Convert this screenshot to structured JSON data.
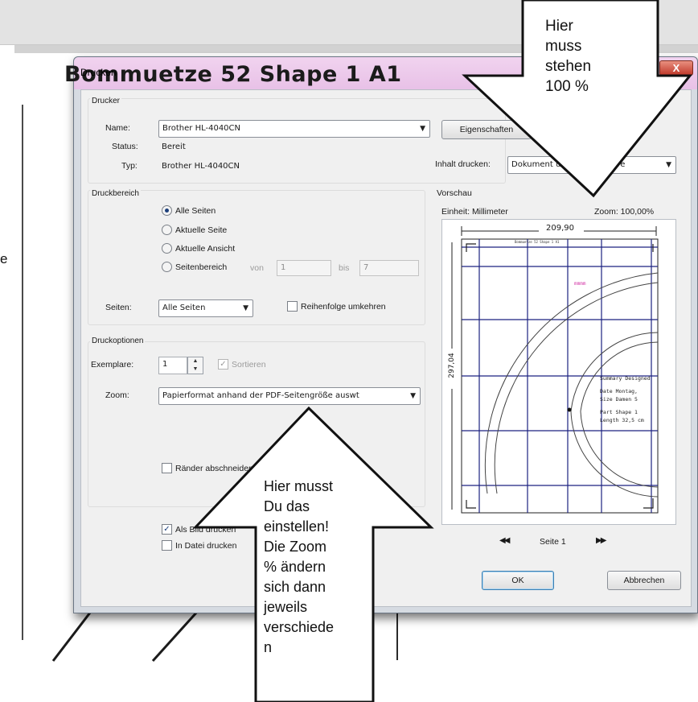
{
  "background": {
    "doc_title": "Bommuetze 52   Shape 1   A1",
    "margin_letter": "e"
  },
  "dialog": {
    "title": "Drucken",
    "close_label": "X"
  },
  "printer": {
    "group_label": "Drucker",
    "name_label": "Name:",
    "name_value": "Brother HL-4040CN",
    "status_label": "Status:",
    "status_value": "Bereit",
    "type_label": "Typ:",
    "type_value": "Brother HL-4040CN",
    "properties_button": "Eigenschaften",
    "content_label": "Inhalt drucken:",
    "content_value": "Dokument und Kommentare"
  },
  "range": {
    "group_label": "Druckbereich",
    "options": [
      "Alle Seiten",
      "Aktuelle Seite",
      "Aktuelle Ansicht",
      "Seitenbereich"
    ],
    "selected_index": 0,
    "from_label": "von",
    "from_value": "1",
    "to_label": "bis",
    "to_value": "7",
    "pages_label": "Seiten:",
    "pages_value": "Alle Seiten",
    "reverse_label": "Reihenfolge umkehren"
  },
  "options": {
    "group_label": "Druckoptionen",
    "copies_label": "Exemplare:",
    "copies_value": "1",
    "collate_label": "Sortieren",
    "zoom_label": "Zoom:",
    "zoom_value": "Papierformat anhand der PDF-Seitengröße auswt",
    "trim_label": "Ränder abschneiden",
    "as_image_label": "Als Bild drucken",
    "to_file_label": "In Datei drucken"
  },
  "preview": {
    "group_label": "Vorschau",
    "unit_label": "Einheit: Millimeter",
    "zoom_label": "Zoom: 100,00%",
    "width_value": "209,90",
    "height_value": "297,04",
    "page_header": "Bommuetze 52   Shape 1   A1",
    "note_pink": "mmmm",
    "table_rows": [
      [
        "Summary",
        "Designed"
      ],
      [
        "Date",
        "Montag,"
      ],
      [
        "Size",
        "Damen 5"
      ],
      [
        "Part",
        "Shape 1"
      ],
      [
        "Length",
        "32,5 cm"
      ]
    ],
    "prev_label": "◀◀",
    "page_label": "Seite 1",
    "next_label": "▶▶"
  },
  "buttons": {
    "ok": "OK",
    "cancel": "Abbrechen"
  },
  "annotations": {
    "top_callout": [
      "Hier",
      "muss",
      "stehen",
      "100 %"
    ],
    "bottom_callout": [
      "Hier musst",
      "Du das",
      "einstellen!",
      "Die Zoom",
      "% ändern",
      "sich dann",
      "jeweils",
      "verschiede",
      "n"
    ]
  },
  "colors": {
    "titlebar": "#e8c1e7",
    "grid_lines": "#1c2280",
    "accent_pink": "#d43aa8"
  }
}
